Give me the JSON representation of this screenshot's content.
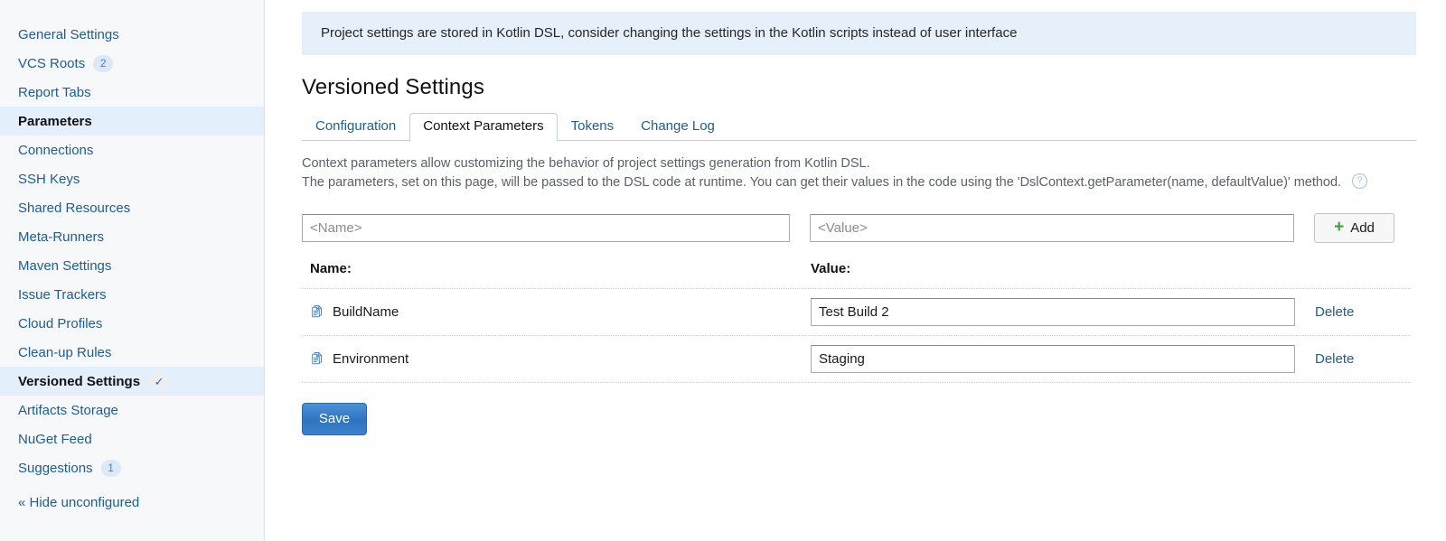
{
  "sidebar": {
    "items": [
      {
        "label": "General Settings",
        "badge": null,
        "active": false,
        "check": false
      },
      {
        "label": "VCS Roots",
        "badge": "2",
        "active": false,
        "check": false
      },
      {
        "label": "Report Tabs",
        "badge": null,
        "active": false,
        "check": false
      },
      {
        "label": "Parameters",
        "badge": null,
        "active": true,
        "check": false
      },
      {
        "label": "Connections",
        "badge": null,
        "active": false,
        "check": false
      },
      {
        "label": "SSH Keys",
        "badge": null,
        "active": false,
        "check": false
      },
      {
        "label": "Shared Resources",
        "badge": null,
        "active": false,
        "check": false
      },
      {
        "label": "Meta-Runners",
        "badge": null,
        "active": false,
        "check": false
      },
      {
        "label": "Maven Settings",
        "badge": null,
        "active": false,
        "check": false
      },
      {
        "label": "Issue Trackers",
        "badge": null,
        "active": false,
        "check": false
      },
      {
        "label": "Cloud Profiles",
        "badge": null,
        "active": false,
        "check": false
      },
      {
        "label": "Clean-up Rules",
        "badge": null,
        "active": false,
        "check": false
      },
      {
        "label": "Versioned Settings",
        "badge": "✓",
        "active": true,
        "check": true
      },
      {
        "label": "Artifacts Storage",
        "badge": null,
        "active": false,
        "check": false
      },
      {
        "label": "NuGet Feed",
        "badge": null,
        "active": false,
        "check": false
      },
      {
        "label": "Suggestions",
        "badge": "1",
        "active": false,
        "check": false
      }
    ],
    "hide_unconfigured": "« Hide unconfigured"
  },
  "notice": {
    "text": "Project settings are stored in Kotlin DSL, consider changing the settings in the Kotlin scripts instead of user interface",
    "bg_color": "#e6f0fb"
  },
  "page": {
    "title": "Versioned Settings"
  },
  "tabs": [
    {
      "label": "Configuration",
      "active": false
    },
    {
      "label": "Context Parameters",
      "active": true
    },
    {
      "label": "Tokens",
      "active": false
    },
    {
      "label": "Change Log",
      "active": false
    }
  ],
  "description": {
    "line1": "Context parameters allow customizing the behavior of project settings generation from Kotlin DSL.",
    "line2": "The parameters, set on this page, will be passed to the DSL code at runtime. You can get their values in the code using the 'DslContext.getParameter(name, defaultValue)' method.",
    "help_glyph": "?"
  },
  "add_form": {
    "name_placeholder": "<Name>",
    "name_value": "",
    "value_placeholder": "<Value>",
    "value_value": "",
    "add_label": "Add",
    "plus_glyph": "+",
    "plus_color": "#3aa33a"
  },
  "table": {
    "headers": {
      "name": "Name:",
      "value": "Value:"
    },
    "rows": [
      {
        "name": "BuildName",
        "value": "Test Build 2",
        "delete_label": "Delete",
        "icon": "document-icon"
      },
      {
        "name": "Environment",
        "value": "Staging",
        "delete_label": "Delete",
        "icon": "document-icon"
      }
    ]
  },
  "footer": {
    "save_label": "Save",
    "save_color": "#3176c2"
  }
}
